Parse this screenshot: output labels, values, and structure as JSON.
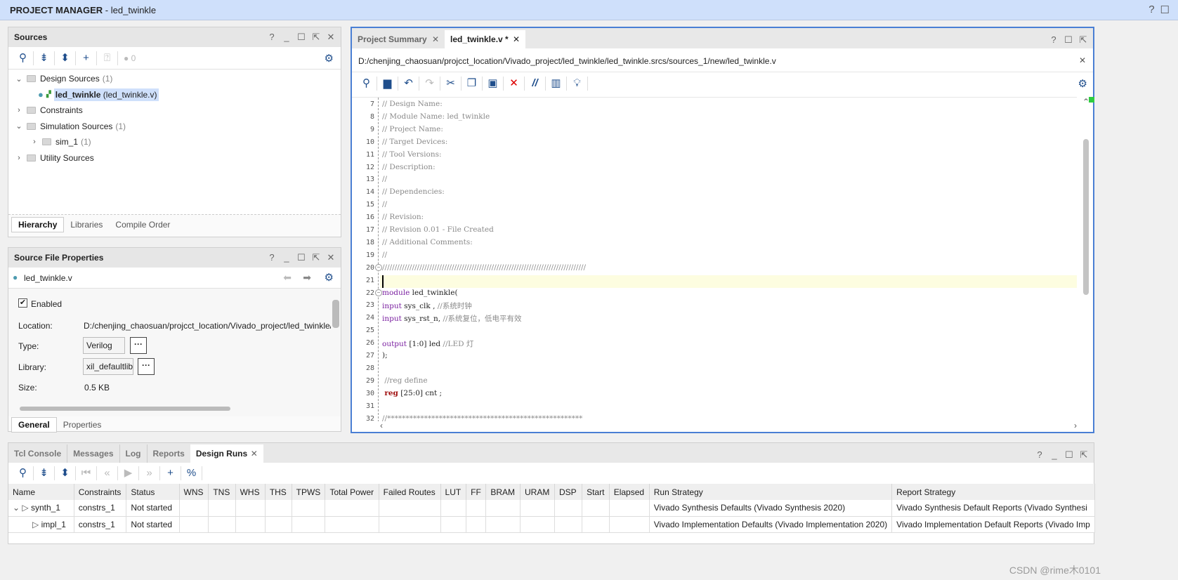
{
  "window": {
    "title_bold": "PROJECT MANAGER",
    "title_rest": " - led_twinkle"
  },
  "sources": {
    "title": "Sources",
    "error_count": "0",
    "tree": [
      {
        "label": "Design Sources",
        "count": "(1)",
        "expanded": true,
        "level": 0
      },
      {
        "label_bold": "led_twinkle",
        "label": " (led_twinkle.v)",
        "level": 1,
        "selected": true
      },
      {
        "label": "Constraints",
        "count": "",
        "expanded": false,
        "level": 0
      },
      {
        "label": "Simulation Sources",
        "count": "(1)",
        "expanded": true,
        "level": 0
      },
      {
        "label": "sim_1",
        "count": "(1)",
        "expanded": false,
        "level": 1
      },
      {
        "label": "Utility Sources",
        "count": "",
        "expanded": false,
        "level": 0
      }
    ],
    "tabs": [
      "Hierarchy",
      "Libraries",
      "Compile Order"
    ]
  },
  "props": {
    "title": "Source File Properties",
    "file": "led_twinkle.v",
    "enabled_label": "Enabled",
    "location_label": "Location:",
    "location": "D:/chenjing_chaosuan/projcct_location/Vivado_project/led_twinkle/le",
    "type_label": "Type:",
    "type": "Verilog",
    "library_label": "Library:",
    "library": "xil_defaultlib",
    "size_label": "Size:",
    "size": "0.5 KB",
    "tabs": [
      "General",
      "Properties"
    ]
  },
  "editor": {
    "tabs": [
      {
        "label": "Project Summary"
      },
      {
        "label": "led_twinkle.v *"
      }
    ],
    "path": "D:/chenjing_chaosuan/projcct_location/Vivado_project/led_twinkle/led_twinkle.srcs/sources_1/new/led_twinkle.v",
    "lines": [
      {
        "n": "7",
        "segs": [
          [
            "c-comment",
            "// Design Name:"
          ]
        ]
      },
      {
        "n": "8",
        "segs": [
          [
            "c-comment",
            "// Module Name: led_twinkle"
          ]
        ]
      },
      {
        "n": "9",
        "segs": [
          [
            "c-comment",
            "// Project Name:"
          ]
        ]
      },
      {
        "n": "10",
        "segs": [
          [
            "c-comment",
            "// Target Devices:"
          ]
        ]
      },
      {
        "n": "11",
        "segs": [
          [
            "c-comment",
            "// Tool Versions:"
          ]
        ]
      },
      {
        "n": "12",
        "segs": [
          [
            "c-comment",
            "// Description:"
          ]
        ]
      },
      {
        "n": "13",
        "segs": [
          [
            "c-comment",
            "//"
          ]
        ]
      },
      {
        "n": "14",
        "segs": [
          [
            "c-comment",
            "// Dependencies:"
          ]
        ]
      },
      {
        "n": "15",
        "segs": [
          [
            "c-comment",
            "//"
          ]
        ]
      },
      {
        "n": "16",
        "segs": [
          [
            "c-comment",
            "// Revision:"
          ]
        ]
      },
      {
        "n": "17",
        "segs": [
          [
            "c-comment",
            "// Revision 0.01 - File Created"
          ]
        ]
      },
      {
        "n": "18",
        "segs": [
          [
            "c-comment",
            "// Additional Comments:"
          ]
        ]
      },
      {
        "n": "19",
        "segs": [
          [
            "c-comment",
            "//"
          ]
        ]
      },
      {
        "n": "20",
        "segs": [
          [
            "c-comment",
            "//////////////////////////////////////////////////////////////////////////////////"
          ]
        ]
      },
      {
        "n": "21",
        "segs": [],
        "current": true
      },
      {
        "n": "22",
        "segs": [
          [
            "c-kw",
            "module"
          ],
          [
            "c-id",
            " led_twinkle("
          ]
        ]
      },
      {
        "n": "23",
        "segs": [
          [
            "c-kw",
            "input"
          ],
          [
            "c-id",
            " sys_clk , "
          ],
          [
            "c-comment",
            "//系统时钟"
          ]
        ]
      },
      {
        "n": "24",
        "segs": [
          [
            "c-kw",
            "input"
          ],
          [
            "c-id",
            " sys_rst_n, "
          ],
          [
            "c-comment",
            "//系统复位，低电平有效"
          ]
        ]
      },
      {
        "n": "25",
        "segs": []
      },
      {
        "n": "26",
        "segs": [
          [
            "c-kw",
            "output"
          ],
          [
            "c-id",
            " [1:0] led "
          ],
          [
            "c-comment",
            "//LED 灯"
          ]
        ]
      },
      {
        "n": "27",
        "segs": [
          [
            "c-id",
            ");"
          ]
        ]
      },
      {
        "n": "28",
        "segs": []
      },
      {
        "n": "29",
        "segs": [
          [
            "c-comment",
            " //reg define"
          ]
        ]
      },
      {
        "n": "30",
        "segs": [
          [
            "c-id",
            " "
          ],
          [
            "c-reg",
            "reg"
          ],
          [
            "c-id",
            " [25:0] cnt ;"
          ]
        ]
      },
      {
        "n": "31",
        "segs": []
      },
      {
        "n": "32",
        "segs": [
          [
            "c-comment",
            "//*****************************************************"
          ]
        ]
      }
    ]
  },
  "bottom": {
    "tabs": [
      "Tcl Console",
      "Messages",
      "Log",
      "Reports",
      "Design Runs"
    ],
    "columns": [
      "Name",
      "Constraints",
      "Status",
      "WNS",
      "TNS",
      "WHS",
      "THS",
      "TPWS",
      "Total Power",
      "Failed Routes",
      "LUT",
      "FF",
      "BRAM",
      "URAM",
      "DSP",
      "Start",
      "Elapsed",
      "Run Strategy",
      "Report Strategy"
    ],
    "rows": [
      {
        "name": "synth_1",
        "constraints": "constrs_1",
        "status": "Not started",
        "run_strategy": "Vivado Synthesis Defaults (Vivado Synthesis 2020)",
        "report_strategy": "Vivado Synthesis Default Reports (Vivado Synthesi"
      },
      {
        "name": "impl_1",
        "constraints": "constrs_1",
        "status": "Not started",
        "run_strategy": "Vivado Implementation Defaults (Vivado Implementation 2020)",
        "report_strategy": "Vivado Implementation Default Reports (Vivado Imp"
      }
    ]
  },
  "watermark": "CSDN @rime木0101",
  "colors": {
    "accent": "#4a7fd4",
    "title_bar": "#cfe0fb",
    "selection": "#cfe0fb",
    "current_line": "#fdfde0"
  }
}
